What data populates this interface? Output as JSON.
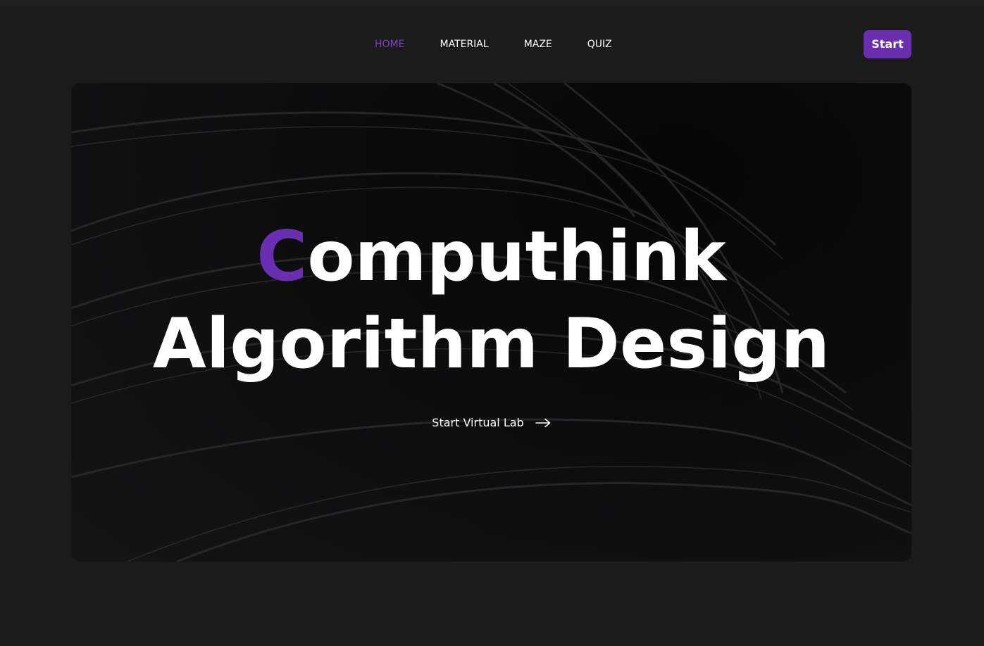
{
  "nav": {
    "items": [
      {
        "label": "HOME",
        "active": true
      },
      {
        "label": "MATERIAL",
        "active": false
      },
      {
        "label": "MAZE",
        "active": false
      },
      {
        "label": "QUIZ",
        "active": false
      }
    ],
    "start_label": "Start"
  },
  "hero": {
    "title_first_letter": "C",
    "title_rest": "omputhink",
    "subtitle": "Algorithm Design",
    "cta_label": "Start Virtual Lab",
    "cta_icon": "arrow-right-icon"
  },
  "colors": {
    "accent": "#6a2fb1",
    "active_nav": "#7a3fc9",
    "page_bg": "#1b1b1c",
    "hero_bg": "#0b0b0c",
    "text": "#ffffff"
  }
}
